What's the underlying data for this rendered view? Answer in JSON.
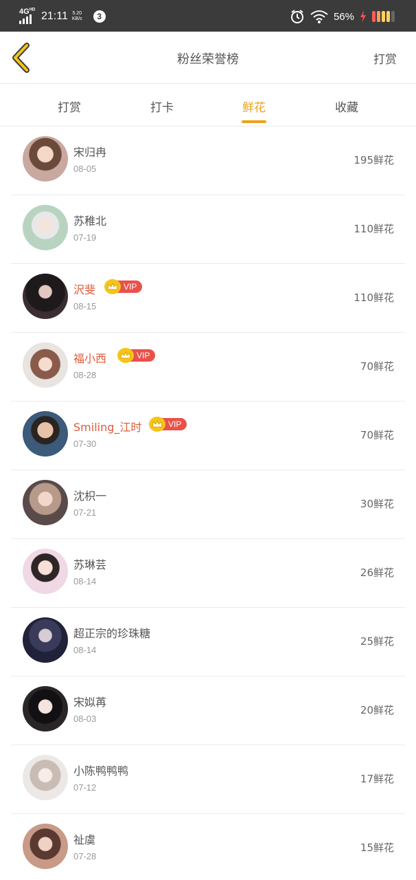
{
  "status_bar": {
    "network": "4G",
    "network_sup": "HD",
    "time": "21:11",
    "speed_value": "5.20",
    "speed_unit": "KB/s",
    "notification_count": "3",
    "battery_percent": "56%"
  },
  "header": {
    "title": "粉丝荣誉榜",
    "action_label": "打赏"
  },
  "tabs": [
    {
      "label": "打赏"
    },
    {
      "label": "打卡"
    },
    {
      "label": "鲜花"
    },
    {
      "label": "收藏"
    }
  ],
  "active_tab": "鲜花",
  "colors": {
    "accent": "#f0a018",
    "vip_name": "#e05a3a",
    "vip_badge": "#e8524a",
    "crown": "#f5c518"
  },
  "vip_label": "VIP",
  "fans": [
    {
      "name": "宋归冉",
      "date": "08-05",
      "amount": "195鲜花",
      "vip": false
    },
    {
      "name": "苏稚北",
      "date": "07-19",
      "amount": "110鲜花",
      "vip": false
    },
    {
      "name": "沢斐",
      "date": "08-15",
      "amount": "110鲜花",
      "vip": true
    },
    {
      "name": "福小西",
      "date": "08-28",
      "amount": "70鲜花",
      "vip": true
    },
    {
      "name": "Smiling_江时",
      "date": "07-30",
      "amount": "70鲜花",
      "vip": true
    },
    {
      "name": "沈枳一",
      "date": "07-21",
      "amount": "30鲜花",
      "vip": false
    },
    {
      "name": "苏琳芸",
      "date": "08-14",
      "amount": "26鲜花",
      "vip": false
    },
    {
      "name": "超正宗的珍珠糖",
      "date": "08-14",
      "amount": "25鲜花",
      "vip": false
    },
    {
      "name": "宋姒苒",
      "date": "08-03",
      "amount": "20鲜花",
      "vip": false
    },
    {
      "name": "小陈鸭鸭鸭",
      "date": "07-12",
      "amount": "17鲜花",
      "vip": false
    },
    {
      "name": "祉虞",
      "date": "07-28",
      "amount": "15鲜花",
      "vip": false
    }
  ]
}
